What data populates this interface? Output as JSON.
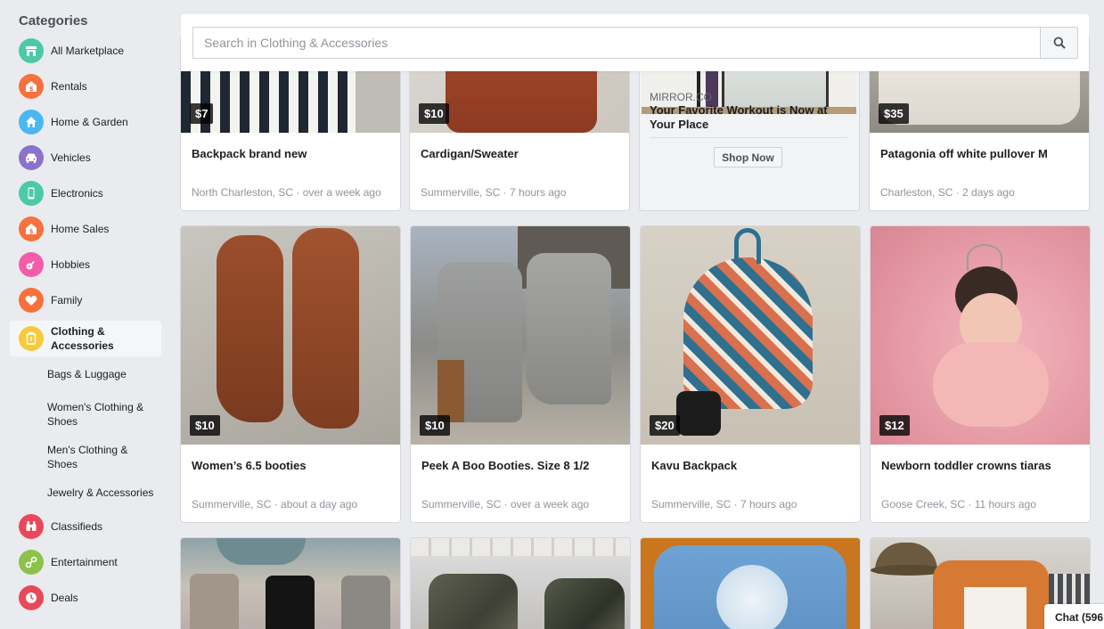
{
  "sidebar": {
    "title": "Categories",
    "items": [
      {
        "label": "All Marketplace",
        "icon": "storefront-icon",
        "color": "#4cc9a7"
      },
      {
        "label": "Rentals",
        "icon": "rental-house-icon",
        "color": "#f7713d"
      },
      {
        "label": "Home & Garden",
        "icon": "home-icon",
        "color": "#49b8f0"
      },
      {
        "label": "Vehicles",
        "icon": "car-icon",
        "color": "#8c72cb"
      },
      {
        "label": "Electronics",
        "icon": "phone-icon",
        "color": "#4cc9a7"
      },
      {
        "label": "Home Sales",
        "icon": "home-sale-icon",
        "color": "#f7713d"
      },
      {
        "label": "Hobbies",
        "icon": "guitar-icon",
        "color": "#f35ca8"
      },
      {
        "label": "Family",
        "icon": "heart-icon",
        "color": "#f7713d"
      },
      {
        "label": "Clothing & Accessories",
        "icon": "clothing-icon",
        "color": "#f7c93d"
      },
      {
        "label": "Classifieds",
        "icon": "binoculars-icon",
        "color": "#e9485b"
      },
      {
        "label": "Entertainment",
        "icon": "tickets-icon",
        "color": "#8bc34a"
      },
      {
        "label": "Deals",
        "icon": "clock-icon",
        "color": "#e9485b"
      }
    ],
    "subitems": [
      "Bags & Luggage",
      "Women's Clothing & Shoes",
      "Men's Clothing & Shoes",
      "Jewelry & Accessories"
    ]
  },
  "search": {
    "placeholder": "Search in Clothing & Accessories"
  },
  "listings": [
    {
      "price": "$7",
      "title": "Backpack brand new",
      "meta": "North Charleston, SC · over a week ago"
    },
    {
      "price": "$10",
      "title": "Cardigan/Sweater",
      "meta": "Summerville, SC · 7 hours ago"
    },
    {
      "price": "$35",
      "title": "Patagonia off white pullover M",
      "meta": "Charleston, SC · 2 days ago"
    },
    {
      "price": "$10",
      "title": "Women’s 6.5 booties",
      "meta": "Summerville, SC · about a day ago"
    },
    {
      "price": "$10",
      "title": "Peek A Boo Booties. Size 8 1/2",
      "meta": "Summerville, SC · over a week ago"
    },
    {
      "price": "$20",
      "title": "Kavu Backpack",
      "meta": "Summerville, SC · 7 hours ago"
    },
    {
      "price": "$12",
      "title": "Newborn toddler crowns tiaras",
      "meta": "Goose Creek, SC · 11 hours ago"
    }
  ],
  "ad": {
    "source": "MIRROR.CO",
    "headline": "Your Favorite Workout is Now at Your Place",
    "button": "Shop Now"
  },
  "chat": {
    "label": "Chat (596"
  }
}
